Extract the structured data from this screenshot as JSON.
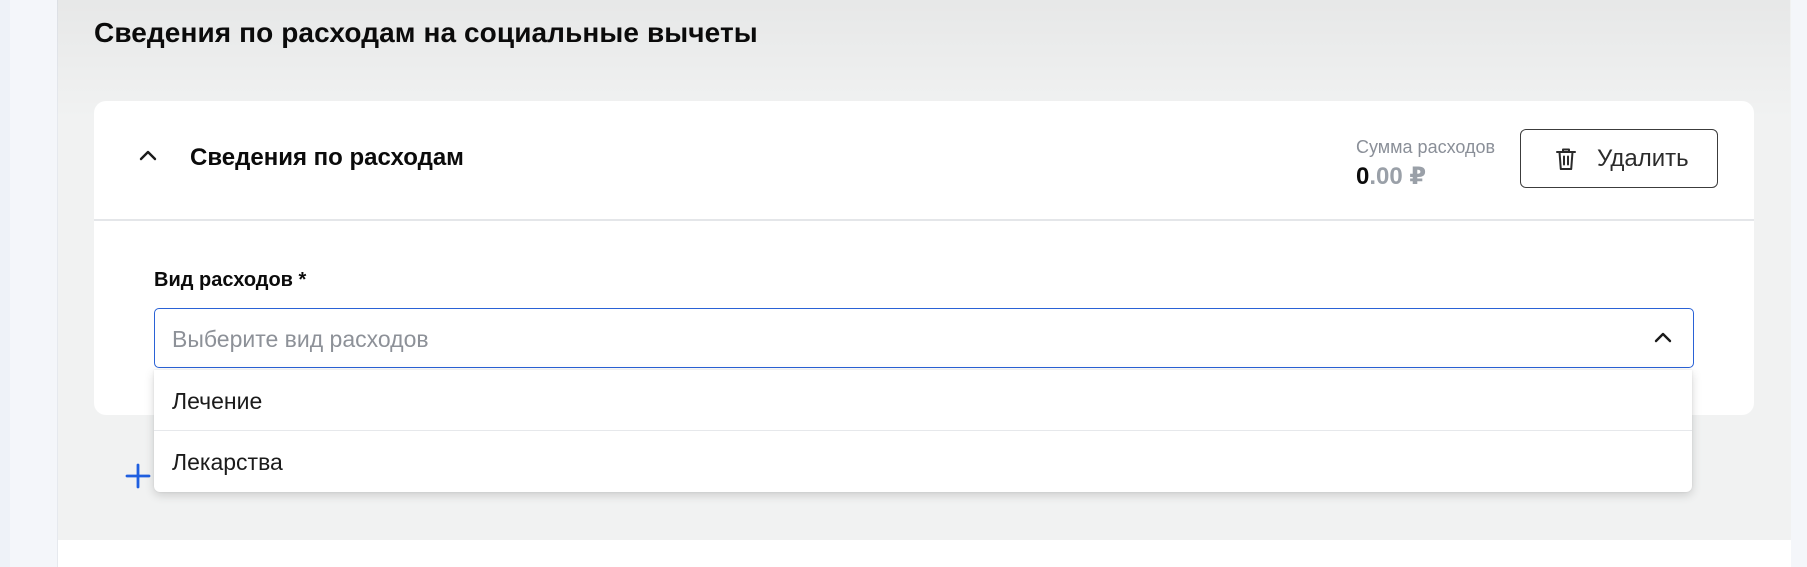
{
  "section": {
    "title": "Сведения по расходам на социальные вычеты"
  },
  "card": {
    "title": "Сведения по расходам",
    "sum_label": "Сумма расходов",
    "sum_integer": "0",
    "sum_fraction": ".00 ₽",
    "delete_label": "Удалить"
  },
  "field": {
    "label": "Вид расходов *",
    "placeholder": "Выберите вид расходов",
    "options": [
      {
        "label": "Лечение"
      },
      {
        "label": "Лекарства"
      }
    ]
  },
  "icons": {
    "collapse": "chevron-up-icon",
    "delete": "trash-icon",
    "select": "chevron-up-icon",
    "add": "plus-icon"
  },
  "colors": {
    "accent": "#2a62d6",
    "add_icon": "#1f5fe0",
    "muted_text": "#8a8f98"
  }
}
